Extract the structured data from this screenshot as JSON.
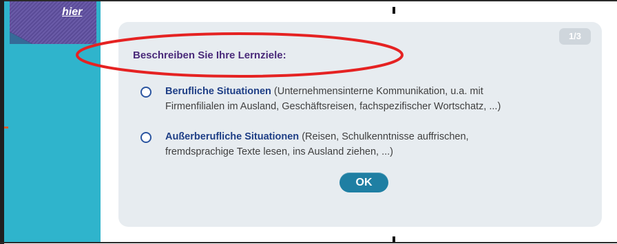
{
  "sidebar": {
    "link_label": "hier"
  },
  "card": {
    "counter": "1/3",
    "question": "Beschreiben Sie Ihre Lernziele:",
    "options": [
      {
        "title": "Berufliche Situationen",
        "description_line1": " (Unternehmensinterne Kommunikation, u.a. mit",
        "description_line2": "Firmenfilialen im Ausland, Geschäftsreisen, fachspezifischer Wortschatz, ...)"
      },
      {
        "title": "Außerberufliche Situationen",
        "description_line1": " (Reisen, Schulkenntnisse auffrischen,",
        "description_line2": "fremdsprachige Texte lesen, ins Ausland ziehen, ...)"
      }
    ],
    "ok_label": "OK"
  },
  "colors": {
    "sidebar": "#2fb4cc",
    "sidebar_tab": "#5a4b97",
    "question_text": "#4a2a7a",
    "option_title": "#1f3f86",
    "ok_button": "#1f7fa3",
    "highlight": "#e52222"
  }
}
